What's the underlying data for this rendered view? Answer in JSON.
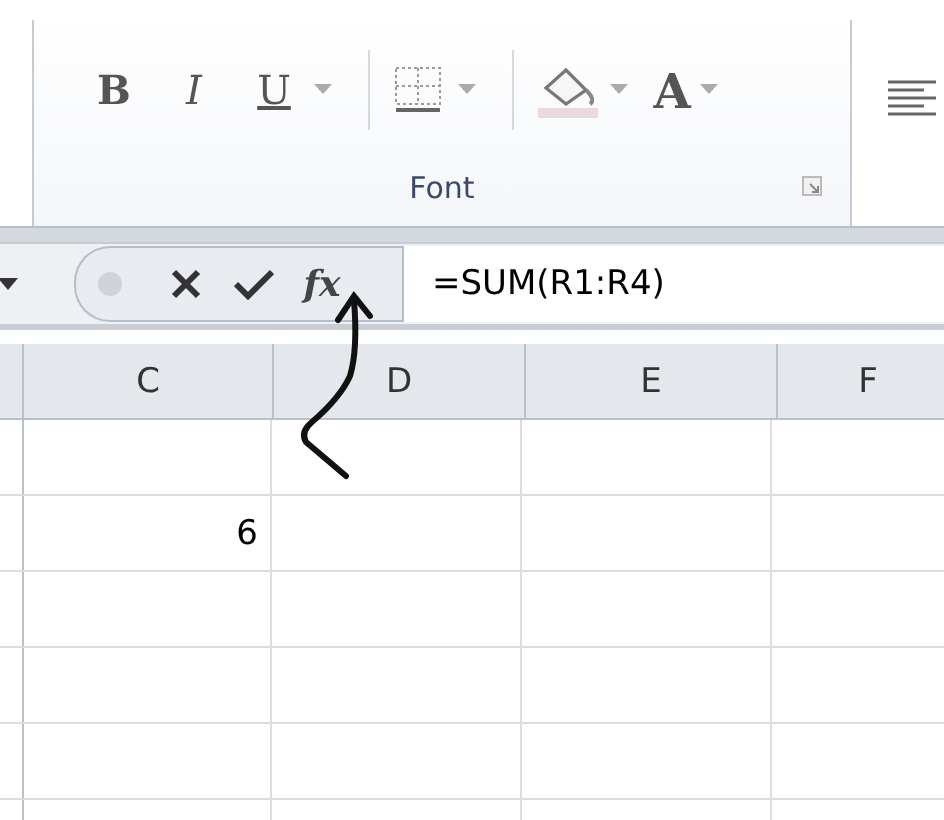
{
  "ribbon": {
    "group_label": "Font",
    "tools": [
      {
        "kind": "bold",
        "label": "B",
        "has_dropdown": false
      },
      {
        "kind": "italic",
        "label": "I",
        "has_dropdown": false
      },
      {
        "kind": "underline",
        "label": "U",
        "has_dropdown": true
      },
      {
        "kind": "borders",
        "has_dropdown": true
      },
      {
        "kind": "fill",
        "has_dropdown": true
      },
      {
        "kind": "font_color",
        "label": "A",
        "has_dropdown": true
      }
    ]
  },
  "formula_bar": {
    "function_label": "fx",
    "formula": "=SUM(R1:R4)"
  },
  "sheet": {
    "columns": [
      "C",
      "D",
      "E",
      "F"
    ],
    "filled_cell": {
      "value": "6"
    }
  }
}
